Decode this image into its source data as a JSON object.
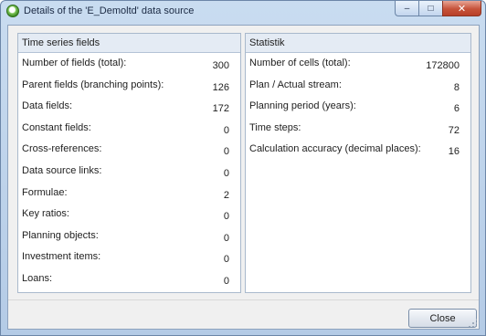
{
  "window": {
    "title": "Details of the 'E_Demoltd' data source",
    "controls": {
      "minimize": "–",
      "maximize": "□",
      "close": "✕"
    }
  },
  "left_panel": {
    "header": "Time series fields",
    "rows": [
      {
        "label": "Number of fields (total):",
        "value": "300"
      },
      {
        "label": "Parent fields (branching points):",
        "value": "126"
      },
      {
        "label": "Data fields:",
        "value": "172"
      },
      {
        "label": "Constant fields:",
        "value": "0"
      },
      {
        "label": "Cross-references:",
        "value": "0"
      },
      {
        "label": "Data source links:",
        "value": "0"
      },
      {
        "label": "Formulae:",
        "value": "2"
      },
      {
        "label": "Key ratios:",
        "value": "0"
      },
      {
        "label": "Planning objects:",
        "value": "0"
      },
      {
        "label": "Investment items:",
        "value": "0"
      },
      {
        "label": "Loans:",
        "value": "0"
      }
    ]
  },
  "right_panel": {
    "header": "Statistik",
    "rows": [
      {
        "label": "Number of cells (total):",
        "value": "172800"
      },
      {
        "label": "Plan / Actual stream:",
        "value": "8"
      },
      {
        "label": "Planning period (years):",
        "value": "6"
      },
      {
        "label": "Time steps:",
        "value": "72"
      },
      {
        "label": "Calculation accuracy (decimal places):",
        "value": "16"
      }
    ]
  },
  "footer": {
    "close_label": "Close"
  }
}
